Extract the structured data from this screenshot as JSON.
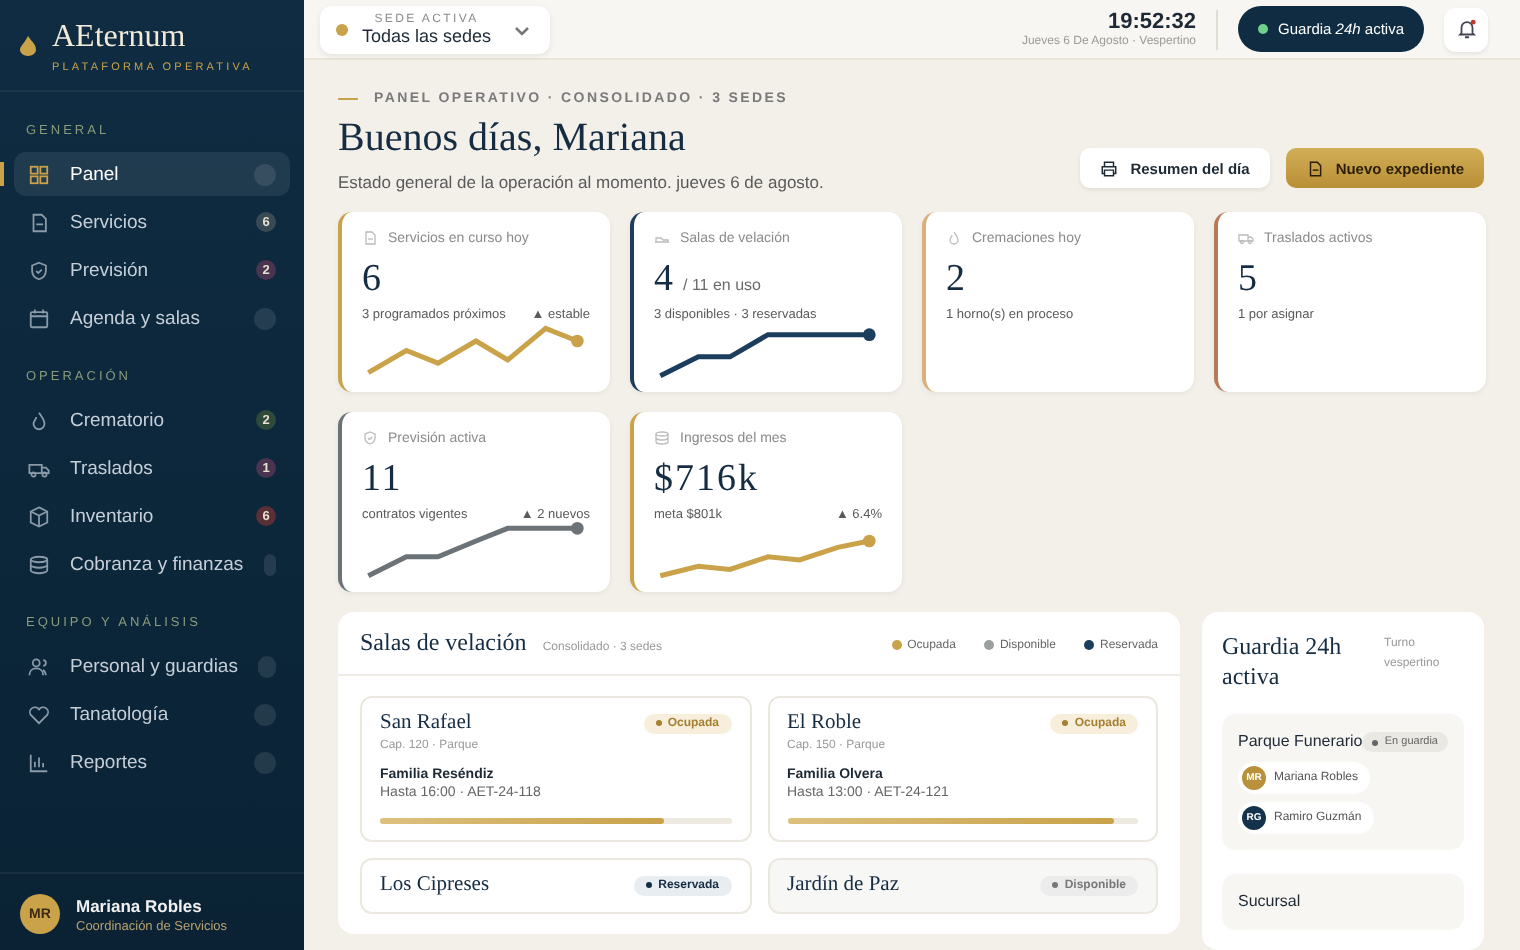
{
  "brand": {
    "name": "AEternum",
    "tagline": "PLATAFORMA OPERATIVA"
  },
  "sidebar": {
    "sections": [
      {
        "title": "GENERAL",
        "items": [
          {
            "label": "Panel",
            "selected": true
          },
          {
            "label": "Servicios",
            "selected": false,
            "badge": "6",
            "color": "#3a4a55"
          },
          {
            "label": "Previsión",
            "selected": false,
            "badge": "2",
            "color": "#4a3550"
          },
          {
            "label": "Agenda y salas",
            "selected": false
          }
        ]
      },
      {
        "title": "OPERACIÓN",
        "items": [
          {
            "label": "Crematorio",
            "selected": false,
            "badge": "2",
            "color": "#2f4a3a"
          },
          {
            "label": "Traslados",
            "selected": false,
            "badge": "1",
            "color": "#4a3550"
          },
          {
            "label": "Inventario",
            "selected": false,
            "badge": "6",
            "color": "#5a3038"
          },
          {
            "label": "Cobranza y finanzas",
            "selected": false
          }
        ]
      },
      {
        "title": "EQUIPO Y ANÁLISIS",
        "items": [
          {
            "label": "Personal y guardias",
            "selected": false
          },
          {
            "label": "Tanatología",
            "selected": false
          },
          {
            "label": "Reportes",
            "selected": false
          }
        ]
      }
    ],
    "user": {
      "initials": "MR",
      "name": "Mariana Robles",
      "role": "Coordinación de Servicios"
    }
  },
  "topbar": {
    "sede_label": "SEDE ACTIVA",
    "sede_value": "Todas las sedes",
    "time": "19:52:32",
    "date": "Jueves 6 De Agosto · Vespertino",
    "guard_button": "Guardia *24h* activa"
  },
  "header": {
    "eyebrow": "PANEL OPERATIVO · CONSOLIDADO · 3 SEDES",
    "title": "Buenos días, Mariana",
    "subtitle": "Estado general de la operación al momento. jueves 6 de agosto.",
    "buttons": [
      {
        "label": "Resumen del día",
        "kind": "secondary"
      },
      {
        "label": "Nuevo expediente",
        "kind": "primary"
      }
    ]
  },
  "metrics": [
    {
      "kind": "trend",
      "title": "Servicios en curso hoy",
      "value": "6",
      "note": "3 programados próximos",
      "trend": "▲ estable",
      "color": "#c9a24a"
    },
    {
      "kind": "trend",
      "title": "Salas de velación",
      "value": "4",
      "suffix": "/ 11 en uso",
      "note": "3 disponibles · 3 reservadas",
      "color": "#1d3d5c"
    },
    {
      "kind": "plain",
      "title": "Cremaciones hoy",
      "value": "2",
      "note": "1 horno(s) en proceso",
      "color": "#d9b07a"
    },
    {
      "kind": "plain",
      "title": "Traslados activos",
      "value": "5",
      "note": "1 por asignar",
      "color": "#b87a55"
    },
    {
      "kind": "trend",
      "title": "Previsión activa",
      "value": "11",
      "note": "contratos vigentes",
      "trend": "▲ 2 nuevos",
      "color": "#6b7378"
    },
    {
      "kind": "trend",
      "title": "Ingresos del mes",
      "value": "$716k",
      "note": "meta $801k",
      "trend": "▲ 6.4%",
      "color": "#c9a24a"
    }
  ],
  "rooms_panel": {
    "title": "Salas de velación",
    "subtitle": "Consolidado · 3 sedes",
    "legend": [
      {
        "label": "Ocupada",
        "color": "#c9a24a"
      },
      {
        "label": "Disponible",
        "color": "#9aa0a0"
      },
      {
        "label": "Reservada",
        "color": "#1d3d5c"
      }
    ],
    "rooms": [
      {
        "name": "San Rafael",
        "status": "Ocupada",
        "kind": "occupied",
        "meta": "Cap. 120 · Parque",
        "family": "Familia Reséndiz",
        "detail": "Hasta 16:00 · AET-24-118",
        "level": 0.81
      },
      {
        "name": "El Roble",
        "status": "Ocupada",
        "kind": "occupied",
        "meta": "Cap. 150 · Parque",
        "family": "Familia Olvera",
        "detail": "Hasta 13:00 · AET-24-121",
        "level": 0.93
      },
      {
        "name": "Los Cipreses",
        "status": "Reservada",
        "kind": "reserved"
      },
      {
        "name": "Jardín de Paz",
        "status": "Disponible",
        "kind": "available"
      }
    ]
  },
  "guard_panel": {
    "title": "Guardia 24h activa",
    "shift": "Turno vespertino",
    "sites": [
      {
        "name": "Parque Funerario",
        "status": "En guardia",
        "staff": [
          {
            "initials": "MR",
            "name": "Mariana Robles",
            "color": "#b8913a"
          },
          {
            "initials": "RG",
            "name": "Ramiro Guzmán",
            "color": "#15324d"
          }
        ]
      },
      {
        "name": "Sucursal"
      }
    ]
  }
}
